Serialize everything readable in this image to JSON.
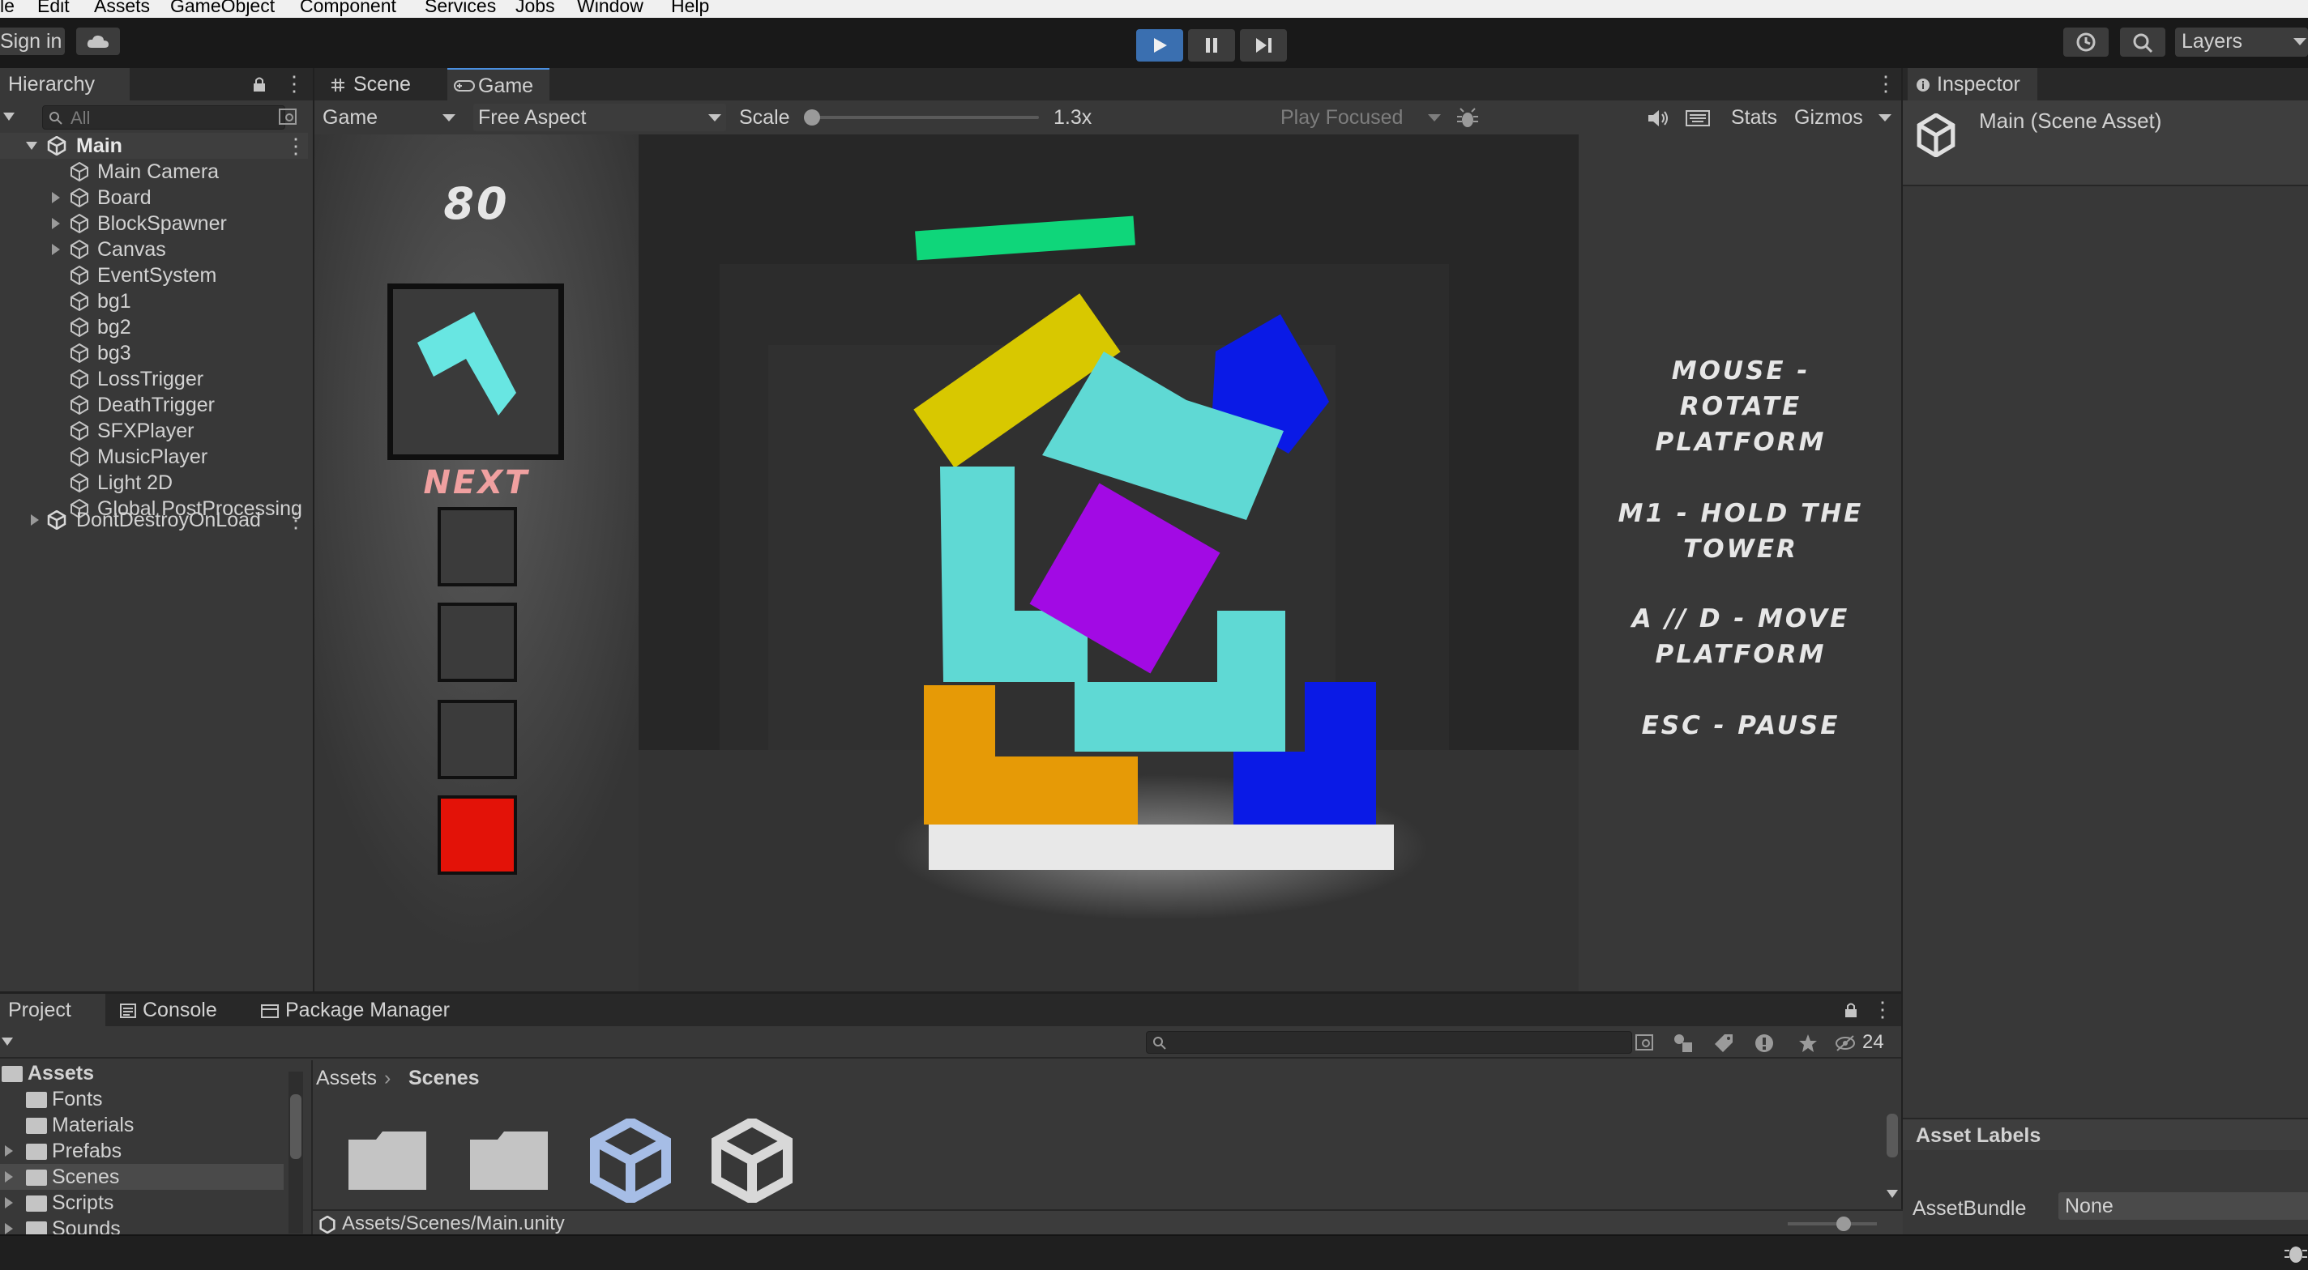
{
  "menu": [
    "le",
    "Edit",
    "Assets",
    "GameObject",
    "Component",
    "Services",
    "Jobs",
    "Window",
    "Help"
  ],
  "toolbar": {
    "sign_in": "Sign in",
    "layers": "Layers",
    "icons": [
      "cloud-icon",
      "play-icon",
      "pause-icon",
      "step-icon",
      "history-icon",
      "search-icon"
    ]
  },
  "hierarchy": {
    "tab": "Hierarchy",
    "search_placeholder": "All",
    "scene": "Main",
    "items": [
      {
        "label": "Main Camera",
        "expandable": false
      },
      {
        "label": "Board",
        "expandable": true
      },
      {
        "label": "BlockSpawner",
        "expandable": true
      },
      {
        "label": "Canvas",
        "expandable": true
      },
      {
        "label": "EventSystem",
        "expandable": false
      },
      {
        "label": "bg1",
        "expandable": false
      },
      {
        "label": "bg2",
        "expandable": false
      },
      {
        "label": "bg3",
        "expandable": false
      },
      {
        "label": "LossTrigger",
        "expandable": false
      },
      {
        "label": "DeathTrigger",
        "expandable": false
      },
      {
        "label": "SFXPlayer",
        "expandable": false
      },
      {
        "label": "MusicPlayer",
        "expandable": false
      },
      {
        "label": "Light 2D",
        "expandable": false
      },
      {
        "label": "Global PostProcessing",
        "expandable": false
      }
    ],
    "ddol": "DontDestroyOnLoad"
  },
  "view": {
    "tabs": [
      "Scene",
      "Game"
    ],
    "active_tab": "Game",
    "display": "Game",
    "aspect": "Free Aspect",
    "scale_label": "Scale",
    "scale_value": "1.3x",
    "scale_fraction": 0.0,
    "play_mode": "Play Focused",
    "stats": "Stats",
    "gizmos": "Gizmos"
  },
  "game": {
    "score": "80",
    "next_label": "NEXT",
    "controls": [
      "MOUSE -\nROTATE\nPLATFORM",
      "M1 - HOLD THE\nTOWER",
      "A // D - MOVE\nPLATFORM",
      "ESC - PAUSE"
    ],
    "colors": {
      "cyan": "#5fd9d4",
      "yellow": "#d8c800",
      "blue": "#0a1ae6",
      "green": "#0fd67a",
      "purple": "#a20ae4",
      "orange": "#e69a06",
      "red": "#e31208",
      "platform": "#e8e8e8"
    }
  },
  "inspector": {
    "tab": "Inspector",
    "title": "Main (Scene Asset)",
    "asset_labels": "Asset Labels",
    "assetbundle_label": "AssetBundle",
    "assetbundle_value": "None"
  },
  "bottom": {
    "tabs": [
      "Project",
      "Console",
      "Package Manager"
    ],
    "tree": [
      "Assets",
      "Fonts",
      "Materials",
      "Prefabs",
      "Scenes",
      "Scripts",
      "Sounds"
    ],
    "breadcrumb": [
      "Assets",
      "Scenes"
    ],
    "path": "Assets/Scenes/Main.unity",
    "hidden_count": "24"
  }
}
